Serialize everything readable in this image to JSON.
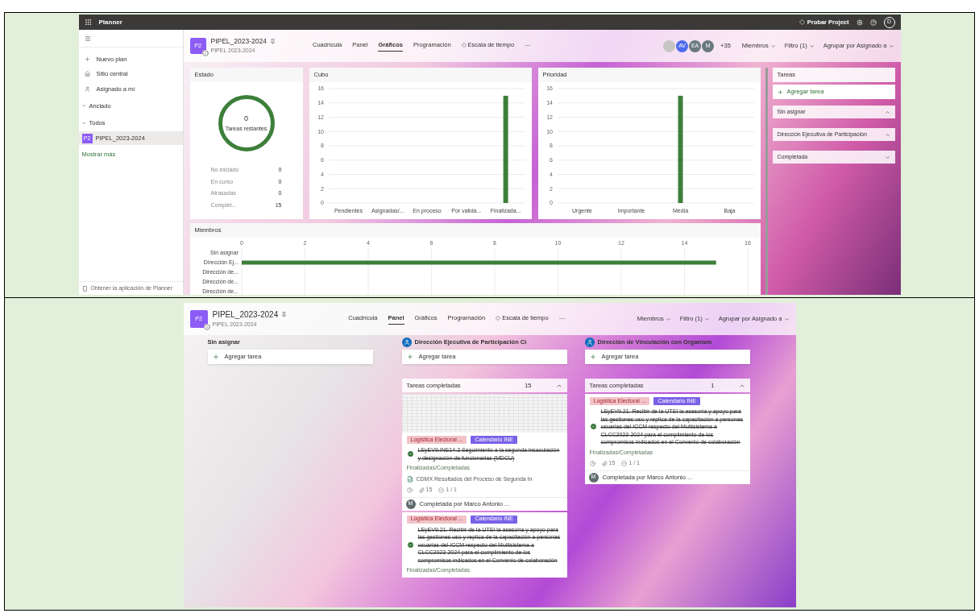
{
  "planner_charts": {
    "app_bar": {
      "title": "Planner",
      "trial": "Probar Project",
      "account": "D"
    },
    "sidebar": {
      "nav": [
        {
          "label": "Nuevo plan"
        },
        {
          "label": "Sitio central"
        },
        {
          "label": "Asignado a mí"
        }
      ],
      "sections": [
        {
          "label": "Anclado",
          "expanded": true
        },
        {
          "label": "Todos",
          "expanded": true,
          "plans": [
            {
              "badge": "P2",
              "label": "PIPEL_2023-2024",
              "selected": true
            }
          ]
        }
      ],
      "show_more": "Mostrar más",
      "get_app": "Obtener la aplicación de Planner"
    },
    "header": {
      "badge": "P2",
      "title": "PIPEL_2023-2024",
      "subtitle": "PIPEL 2023-2024",
      "tabs": [
        {
          "label": "Cuadrícula",
          "selected": false,
          "premium": false
        },
        {
          "label": "Panel",
          "selected": false,
          "premium": false
        },
        {
          "label": "Gráficos",
          "selected": true,
          "premium": false
        },
        {
          "label": "Programación",
          "selected": false,
          "premium": false
        },
        {
          "label": "Escala de tiempo",
          "selected": false,
          "premium": true
        }
      ],
      "more": "···",
      "members": [
        {
          "kind": "photo"
        },
        {
          "kind": "initials",
          "initials": "AV",
          "color": "#4f6bed"
        },
        {
          "kind": "initials",
          "initials": "EA",
          "color": "#69797e"
        },
        {
          "kind": "initials",
          "initials": "M",
          "color": "#69797e"
        }
      ],
      "extra_members": "+35",
      "filters": [
        "Miembros",
        "Filtro (1)",
        "Agrupar por Asignado a"
      ]
    },
    "status": {
      "title": "Estado",
      "remaining": "0",
      "remaining_label": "Tareas restantes",
      "rows": [
        {
          "label": "No iniciado",
          "value": "0"
        },
        {
          "label": "En curso",
          "value": "0"
        },
        {
          "label": "Atrasadas",
          "value": "0"
        },
        {
          "label": "Complet...",
          "value": "15"
        }
      ]
    },
    "bucket_chart": {
      "title": "Cubo",
      "chart_data": {
        "type": "bar",
        "categories": [
          "Pendientes",
          "Asignadas/...",
          "En proceso",
          "Por valida...",
          "Finalizada..."
        ],
        "series": [
          {
            "color": "#3d7f3a",
            "values": [
              0,
              0,
              0,
              0,
              15
            ]
          }
        ],
        "ylim": [
          0,
          16
        ],
        "yticks": [
          0,
          2,
          4,
          6,
          8,
          10,
          12,
          14,
          16
        ],
        "grid": true
      }
    },
    "priority_chart": {
      "title": "Prioridad",
      "chart_data": {
        "type": "bar",
        "categories": [
          "Urgente",
          "Importante",
          "Media",
          "Baja"
        ],
        "series": [
          {
            "color": "#3d7f3a",
            "values": [
              0,
              0,
              15,
              0
            ]
          }
        ],
        "ylim": [
          0,
          16
        ],
        "yticks": [
          0,
          2,
          4,
          6,
          8,
          10,
          12,
          14,
          16
        ],
        "grid": true
      }
    },
    "members_chart": {
      "title": "Miembros",
      "chart_data": {
        "type": "bar",
        "orientation": "horizontal",
        "categories": [
          "Sin asignar",
          "Dirección Ej...",
          "Dirección de...",
          "Dirección de...",
          "Dirección de..."
        ],
        "series": [
          {
            "color": "#3d7f3a",
            "values": [
              0,
              15,
              0,
              0,
              0
            ]
          }
        ],
        "xlim": [
          0,
          16
        ],
        "xticks": [
          0,
          2,
          4,
          6,
          8,
          10,
          12,
          14,
          16
        ],
        "grid": true
      }
    },
    "tasks_panel": {
      "title": "Tareas",
      "add": "Agregar tarea",
      "groups": [
        {
          "label": "Sin asignar",
          "expanded": true
        },
        {
          "label": "Dirección Ejecutiva de Participación",
          "expanded": true
        },
        {
          "label": "Completada",
          "expanded": false
        }
      ]
    }
  },
  "planner_board": {
    "header": {
      "badge": "P2",
      "title": "PIPEL_2023-2024",
      "subtitle": "PIPEL 2023-2024",
      "tabs": [
        {
          "label": "Cuadrícula",
          "selected": false,
          "premium": false
        },
        {
          "label": "Panel",
          "selected": true,
          "premium": false
        },
        {
          "label": "Gráficos",
          "selected": false,
          "premium": false
        },
        {
          "label": "Programación",
          "selected": false,
          "premium": false
        },
        {
          "label": "Escala de tiempo",
          "selected": false,
          "premium": true
        }
      ],
      "more": "···",
      "filters": [
        "Miembros",
        "Filtro (1)",
        "Agrupar por Asignado a"
      ]
    },
    "columns": [
      {
        "kind": "unassigned",
        "title": "Sin asignar",
        "add": "Agregar tarea"
      },
      {
        "kind": "person",
        "title": "Dirección Ejecutiva de Participación Ci",
        "add": "Agregar tarea",
        "completed": {
          "label": "Tareas completadas",
          "count": "15",
          "expanded": true,
          "cards": [
            {
              "preview": true,
              "labels": [
                {
                  "text": "Logística Electoral ...",
                  "color": "#f2c4c9"
                },
                {
                  "text": "Calendario INE",
                  "color": "#7b61e8"
                }
              ],
              "completed": true,
              "title": "LEyEV9.INE14.3 Seguimiento a la segunda insaculación y designación de funcionarias (MDCU)",
              "bucket": "Finalizadas/Completadas",
              "attachment": "CDMX Resultados del Proceso de Segunda In",
              "attachments_count": "15",
              "checklist": "1 / 1",
              "footer": {
                "initial": "M",
                "text": "Completada por Marco Antonio ..."
              }
            },
            {
              "preview": false,
              "labels": [
                {
                  "text": "Logística Electoral ...",
                  "color": "#f2c4c9"
                },
                {
                  "text": "Calendario INE",
                  "color": "#7b61e8"
                }
              ],
              "completed": true,
              "title": "LEyEV9.21. Recibir de la UTSI la asesoría y apoyo para las gestiones uso y replica de la capacitación a personas usuarias del ICCM respecto del Multisistema a CLCC2023-2024 para el cumplimiento de los compromisos indicados en el Convenio de colaboración",
              "bucket": "Finalizadas/Completadas"
            }
          ]
        }
      },
      {
        "kind": "person",
        "title": "Dirección de Vinculación con Organism",
        "add": "Agregar tarea",
        "completed": {
          "label": "Tareas completadas",
          "count": "1",
          "expanded": true,
          "cards": [
            {
              "preview": false,
              "labels": [
                {
                  "text": "Logística Electoral ...",
                  "color": "#f2c4c9"
                },
                {
                  "text": "Calendario INE",
                  "color": "#7b61e8"
                }
              ],
              "completed": true,
              "title": "LEyEV9.21. Recibir de la UTSI la asesoría y apoyo para las gestiones uso y replica de la capacitación a personas usuarias del ICCM respecto del Multisistema a CLCC2023-2024 para el cumplimiento de los compromisos indicados en el Convenio de colaboración",
              "bucket": "Finalizadas/Completadas",
              "attachments_count": "15",
              "checklist": "1 / 1",
              "footer": {
                "initial": "M",
                "text": "Completada por Marco Antonio ..."
              }
            }
          ]
        }
      }
    ]
  }
}
